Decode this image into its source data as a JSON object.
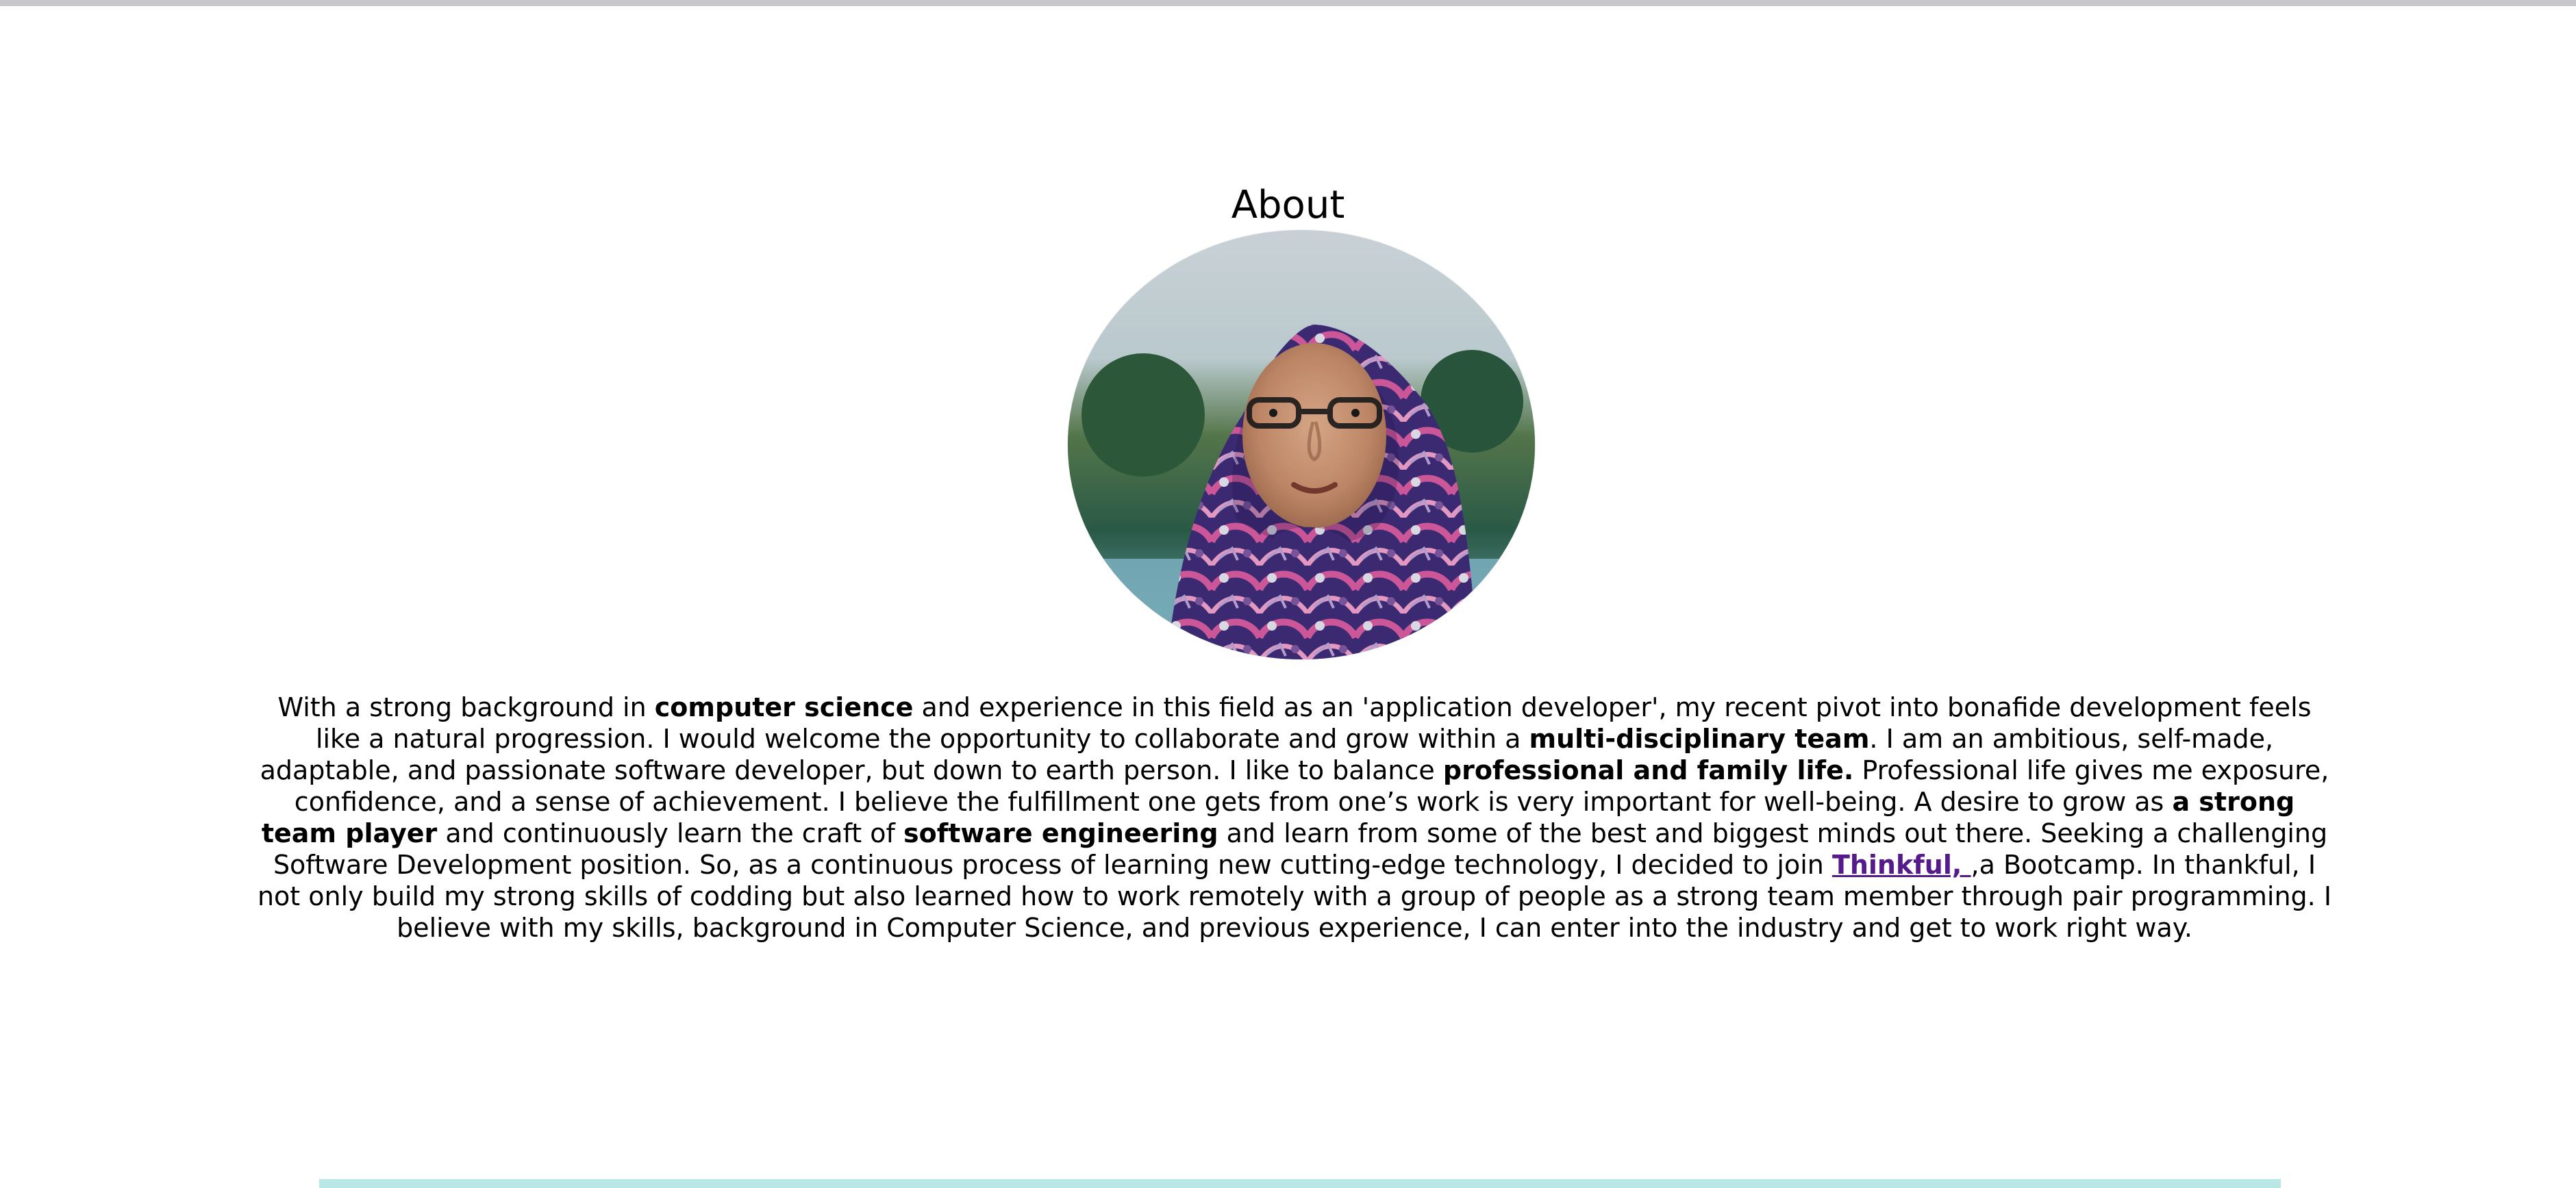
{
  "about": {
    "title": "About",
    "bio": {
      "segments": [
        {
          "text": "With a strong background in ",
          "bold": false
        },
        {
          "text": "computer science",
          "bold": true
        },
        {
          "text": " and experience in this field as an 'application developer', my recent pivot into bonafide development feels like a natural progression. I would welcome the opportunity to collaborate and grow within a ",
          "bold": false
        },
        {
          "text": "multi-disciplinary team",
          "bold": true
        },
        {
          "text": ". I am an ambitious, self-made, adaptable, and passionate software developer, but down to earth person. I like to balance ",
          "bold": false
        },
        {
          "text": "professional and family life.",
          "bold": true
        },
        {
          "text": " Professional life gives me exposure, confidence, and a sense of achievement. I believe the fulfillment one gets from one’s work is very important for well-being. A desire to grow as ",
          "bold": false
        },
        {
          "text": "a strong team player",
          "bold": true
        },
        {
          "text": " and continuously learn the craft of ",
          "bold": false
        },
        {
          "text": "software engineering",
          "bold": true
        },
        {
          "text": " and learn from some of the best and biggest minds out there. Seeking a challenging Software Development position. So, as a continuous process of learning new cutting-edge technology, I decided to join ",
          "bold": false
        },
        {
          "text": "Thinkful, ",
          "link": true
        },
        {
          "text": ",a Bootcamp. In thankful, I not only build my strong skills of codding but also learned how to work remotely with a group of people as a strong team member through pair programming. I believe with my skills, background in Computer Science, and previous experience, I can enter into the industry and get to work right way.",
          "bold": false
        }
      ]
    }
  },
  "colors": {
    "top_border": "#c7c7cc",
    "bottom_bar": "#b8e7e6",
    "link": "#551a8b",
    "text": "#000000",
    "background": "#ffffff"
  }
}
